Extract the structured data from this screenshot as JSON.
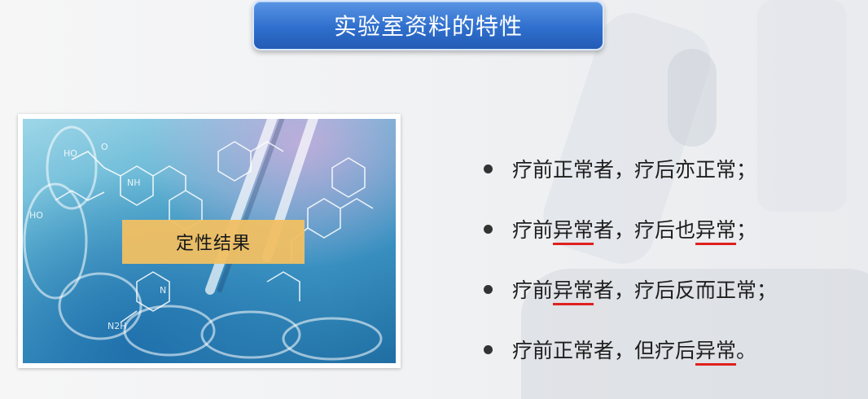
{
  "title": "实验室资料的特性",
  "image": {
    "label": "定性结果",
    "molecule_labels": [
      "HO",
      "HO",
      "NH",
      "N2H",
      "N",
      "O"
    ]
  },
  "bullets": [
    {
      "pre": "疗前正常者，疗后亦正常；"
    },
    {
      "pre": "疗前",
      "u1": "异常",
      "mid": "者，疗后也",
      "u2": "异常",
      "post": "；"
    },
    {
      "pre": "疗前",
      "u1": "异常",
      "mid": "者，疗后反而正常；"
    },
    {
      "pre": "疗前正常者，但疗后",
      "u1": "异常",
      "post": "。"
    }
  ],
  "colors": {
    "title_bg": "#2f6fcd",
    "label_bg": "#f2c063",
    "underline": "#e02020"
  }
}
